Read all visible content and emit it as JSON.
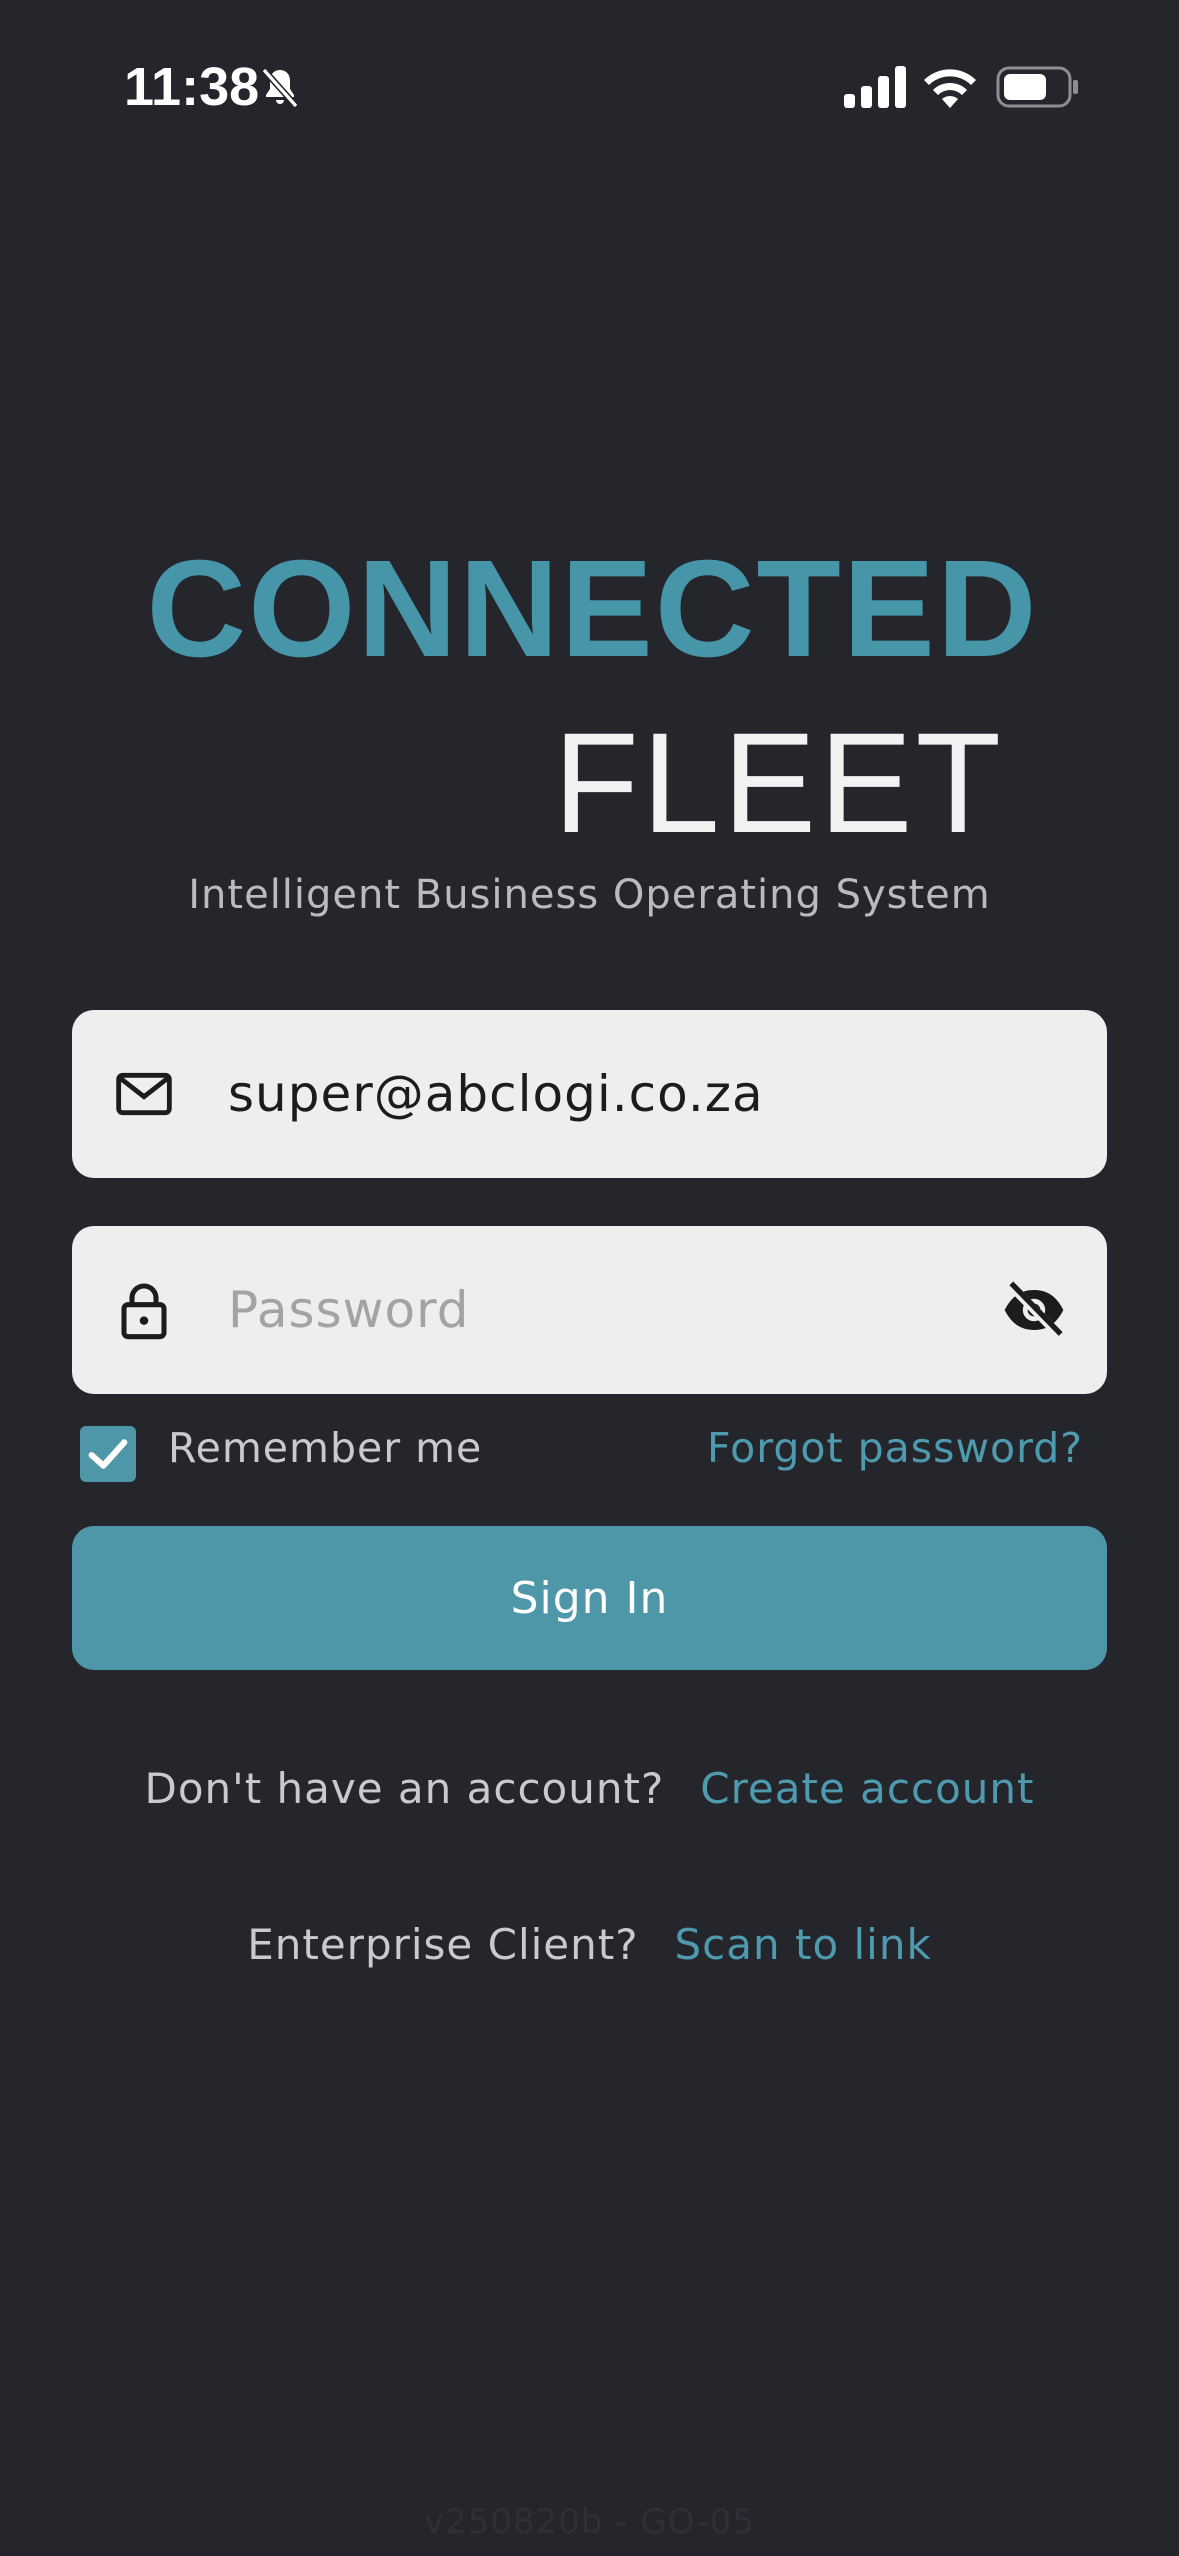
{
  "status_bar": {
    "time": "11:38",
    "icons": [
      "bell-slash-icon",
      "cellular-signal-icon",
      "wifi-icon",
      "battery-icon"
    ]
  },
  "logo": {
    "line1": "CONNECTED",
    "line2": "FLEET",
    "tagline": "Intelligent Business Operating System"
  },
  "form": {
    "email_value": "super@abclogi.co.za",
    "password_placeholder": "Password",
    "remember_label": "Remember me",
    "remember_checked": true,
    "forgot_label": "Forgot password?",
    "signin_label": "Sign In"
  },
  "signup": {
    "prompt": "Don't have an account?",
    "link": "Create account"
  },
  "enterprise": {
    "prompt": "Enterprise Client?",
    "link": "Scan to link"
  },
  "footer": {
    "version": "v250820b - GO-05"
  },
  "colors": {
    "background": "#25262c",
    "accent": "#4e97a9",
    "logo_accent": "#4695a8",
    "field_bg": "#eeeeee"
  }
}
